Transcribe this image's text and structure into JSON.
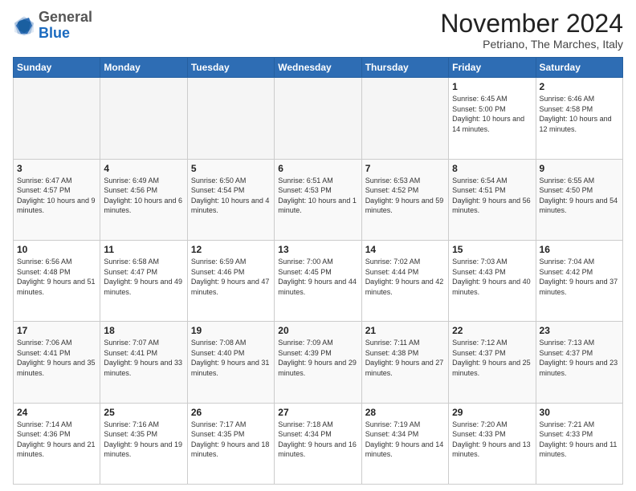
{
  "logo": {
    "general": "General",
    "blue": "Blue"
  },
  "header": {
    "month": "November 2024",
    "location": "Petriano, The Marches, Italy"
  },
  "days_of_week": [
    "Sunday",
    "Monday",
    "Tuesday",
    "Wednesday",
    "Thursday",
    "Friday",
    "Saturday"
  ],
  "weeks": [
    [
      {
        "day": "",
        "info": ""
      },
      {
        "day": "",
        "info": ""
      },
      {
        "day": "",
        "info": ""
      },
      {
        "day": "",
        "info": ""
      },
      {
        "day": "",
        "info": ""
      },
      {
        "day": "1",
        "info": "Sunrise: 6:45 AM\nSunset: 5:00 PM\nDaylight: 10 hours and 14 minutes."
      },
      {
        "day": "2",
        "info": "Sunrise: 6:46 AM\nSunset: 4:58 PM\nDaylight: 10 hours and 12 minutes."
      }
    ],
    [
      {
        "day": "3",
        "info": "Sunrise: 6:47 AM\nSunset: 4:57 PM\nDaylight: 10 hours and 9 minutes."
      },
      {
        "day": "4",
        "info": "Sunrise: 6:49 AM\nSunset: 4:56 PM\nDaylight: 10 hours and 6 minutes."
      },
      {
        "day": "5",
        "info": "Sunrise: 6:50 AM\nSunset: 4:54 PM\nDaylight: 10 hours and 4 minutes."
      },
      {
        "day": "6",
        "info": "Sunrise: 6:51 AM\nSunset: 4:53 PM\nDaylight: 10 hours and 1 minute."
      },
      {
        "day": "7",
        "info": "Sunrise: 6:53 AM\nSunset: 4:52 PM\nDaylight: 9 hours and 59 minutes."
      },
      {
        "day": "8",
        "info": "Sunrise: 6:54 AM\nSunset: 4:51 PM\nDaylight: 9 hours and 56 minutes."
      },
      {
        "day": "9",
        "info": "Sunrise: 6:55 AM\nSunset: 4:50 PM\nDaylight: 9 hours and 54 minutes."
      }
    ],
    [
      {
        "day": "10",
        "info": "Sunrise: 6:56 AM\nSunset: 4:48 PM\nDaylight: 9 hours and 51 minutes."
      },
      {
        "day": "11",
        "info": "Sunrise: 6:58 AM\nSunset: 4:47 PM\nDaylight: 9 hours and 49 minutes."
      },
      {
        "day": "12",
        "info": "Sunrise: 6:59 AM\nSunset: 4:46 PM\nDaylight: 9 hours and 47 minutes."
      },
      {
        "day": "13",
        "info": "Sunrise: 7:00 AM\nSunset: 4:45 PM\nDaylight: 9 hours and 44 minutes."
      },
      {
        "day": "14",
        "info": "Sunrise: 7:02 AM\nSunset: 4:44 PM\nDaylight: 9 hours and 42 minutes."
      },
      {
        "day": "15",
        "info": "Sunrise: 7:03 AM\nSunset: 4:43 PM\nDaylight: 9 hours and 40 minutes."
      },
      {
        "day": "16",
        "info": "Sunrise: 7:04 AM\nSunset: 4:42 PM\nDaylight: 9 hours and 37 minutes."
      }
    ],
    [
      {
        "day": "17",
        "info": "Sunrise: 7:06 AM\nSunset: 4:41 PM\nDaylight: 9 hours and 35 minutes."
      },
      {
        "day": "18",
        "info": "Sunrise: 7:07 AM\nSunset: 4:41 PM\nDaylight: 9 hours and 33 minutes."
      },
      {
        "day": "19",
        "info": "Sunrise: 7:08 AM\nSunset: 4:40 PM\nDaylight: 9 hours and 31 minutes."
      },
      {
        "day": "20",
        "info": "Sunrise: 7:09 AM\nSunset: 4:39 PM\nDaylight: 9 hours and 29 minutes."
      },
      {
        "day": "21",
        "info": "Sunrise: 7:11 AM\nSunset: 4:38 PM\nDaylight: 9 hours and 27 minutes."
      },
      {
        "day": "22",
        "info": "Sunrise: 7:12 AM\nSunset: 4:37 PM\nDaylight: 9 hours and 25 minutes."
      },
      {
        "day": "23",
        "info": "Sunrise: 7:13 AM\nSunset: 4:37 PM\nDaylight: 9 hours and 23 minutes."
      }
    ],
    [
      {
        "day": "24",
        "info": "Sunrise: 7:14 AM\nSunset: 4:36 PM\nDaylight: 9 hours and 21 minutes."
      },
      {
        "day": "25",
        "info": "Sunrise: 7:16 AM\nSunset: 4:35 PM\nDaylight: 9 hours and 19 minutes."
      },
      {
        "day": "26",
        "info": "Sunrise: 7:17 AM\nSunset: 4:35 PM\nDaylight: 9 hours and 18 minutes."
      },
      {
        "day": "27",
        "info": "Sunrise: 7:18 AM\nSunset: 4:34 PM\nDaylight: 9 hours and 16 minutes."
      },
      {
        "day": "28",
        "info": "Sunrise: 7:19 AM\nSunset: 4:34 PM\nDaylight: 9 hours and 14 minutes."
      },
      {
        "day": "29",
        "info": "Sunrise: 7:20 AM\nSunset: 4:33 PM\nDaylight: 9 hours and 13 minutes."
      },
      {
        "day": "30",
        "info": "Sunrise: 7:21 AM\nSunset: 4:33 PM\nDaylight: 9 hours and 11 minutes."
      }
    ]
  ]
}
